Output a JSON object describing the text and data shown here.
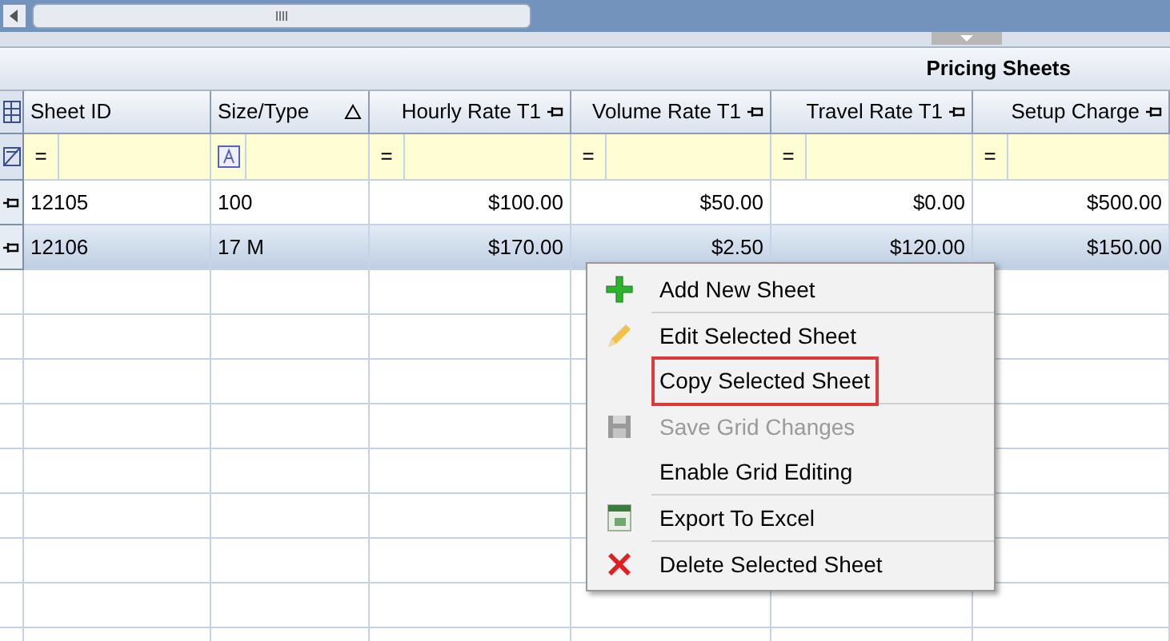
{
  "grid": {
    "title": "Pricing Sheets",
    "columns": [
      {
        "label": "Sheet ID",
        "kind": "text",
        "sorted": false,
        "pinned": false,
        "filter": "="
      },
      {
        "label": "Size/Type",
        "kind": "text",
        "sorted": true,
        "pinned": false
      },
      {
        "label": "Hourly Rate T1",
        "kind": "money",
        "sorted": false,
        "pinned": true,
        "filter": "="
      },
      {
        "label": "Volume Rate T1",
        "kind": "money",
        "sorted": false,
        "pinned": true,
        "filter": "="
      },
      {
        "label": "Travel Rate T1",
        "kind": "money",
        "sorted": false,
        "pinned": true,
        "filter": "="
      },
      {
        "label": "Setup Charge",
        "kind": "money",
        "sorted": false,
        "pinned": true,
        "filter": "="
      }
    ],
    "rows": [
      {
        "selected": false,
        "cells": [
          "12105",
          "100",
          "$100.00",
          "$50.00",
          "$0.00",
          "$500.00"
        ]
      },
      {
        "selected": true,
        "cells": [
          "12106",
          "17 M",
          "$170.00",
          "$2.50",
          "$120.00",
          "$150.00"
        ]
      }
    ]
  },
  "context_menu": {
    "groups": [
      [
        {
          "label": "Add New Sheet",
          "kind": "add",
          "disabled": false,
          "highlighted": false
        }
      ],
      [
        {
          "label": "Edit Selected Sheet",
          "kind": "edit",
          "disabled": false,
          "highlighted": false
        },
        {
          "label": "Copy Selected Sheet",
          "kind": "copy",
          "disabled": false,
          "highlighted": true
        }
      ],
      [
        {
          "label": "Save Grid Changes",
          "kind": "save",
          "disabled": true,
          "highlighted": false
        },
        {
          "label": "Enable Grid Editing",
          "kind": "toggle",
          "disabled": false,
          "highlighted": false
        }
      ],
      [
        {
          "label": "Export To Excel",
          "kind": "excel",
          "disabled": false,
          "highlighted": false
        }
      ],
      [
        {
          "label": "Delete Selected Sheet",
          "kind": "delete",
          "disabled": false,
          "highlighted": false
        }
      ]
    ]
  }
}
